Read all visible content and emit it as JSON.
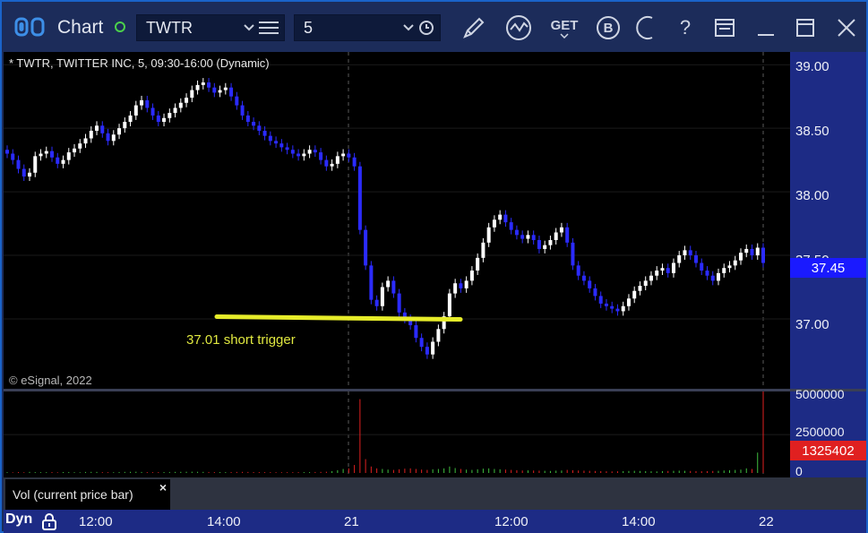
{
  "toolbar": {
    "app_title": "Chart",
    "symbol": "TWTR",
    "interval": "5",
    "get_label": "GET",
    "b_label": "B",
    "help_label": "?"
  },
  "chart": {
    "caption": "* TWTR, TWITTER INC, 5, 09:30-16:00 (Dynamic)",
    "copyright": "© eSignal, 2022",
    "annotation": "37.01 short trigger",
    "annotation_color": "#e0e840",
    "current_price": "37.45",
    "current_price_color": "#1a1aff",
    "current_volume": "1325402",
    "current_volume_color": "#e02020",
    "volume_legend": "Vol (current price bar)",
    "volume_legend_close": "×",
    "mode_label": "Dyn"
  },
  "chart_data": {
    "type": "candlestick",
    "title": "* TWTR, TWITTER INC, 5, 09:30-16:00 (Dynamic)",
    "y_axis_ticks": [
      "39.00",
      "38.50",
      "38.00",
      "37.50",
      "37.00"
    ],
    "ylim": [
      36.45,
      39.1
    ],
    "volume_axis_ticks": [
      "5000000",
      "2500000",
      "0"
    ],
    "x_axis_ticks": [
      "12:00",
      "14:00",
      "21",
      "12:00",
      "14:00",
      "22"
    ],
    "trigger_line": {
      "price": 37.01,
      "label": "37.01 short trigger"
    },
    "last_price": 37.45,
    "last_volume": 1325402,
    "closes": [
      38.3,
      38.25,
      38.18,
      38.12,
      38.15,
      38.28,
      38.3,
      38.32,
      38.27,
      38.22,
      38.25,
      38.31,
      38.34,
      38.38,
      38.42,
      38.48,
      38.52,
      38.46,
      38.4,
      38.45,
      38.5,
      38.55,
      38.6,
      38.68,
      38.72,
      38.66,
      38.6,
      38.55,
      38.58,
      38.62,
      38.66,
      38.7,
      38.74,
      38.8,
      38.84,
      38.86,
      38.82,
      38.78,
      38.8,
      38.82,
      38.75,
      38.68,
      38.6,
      38.55,
      38.52,
      38.48,
      38.44,
      38.4,
      38.38,
      38.35,
      38.33,
      38.3,
      38.28,
      38.3,
      38.33,
      38.31,
      38.25,
      38.2,
      38.22,
      38.28,
      38.3,
      38.27,
      38.2,
      37.7,
      37.42,
      37.15,
      37.1,
      37.25,
      37.3,
      37.2,
      37.05,
      37.0,
      36.95,
      36.85,
      36.78,
      36.72,
      36.82,
      36.92,
      37.02,
      37.2,
      37.28,
      37.24,
      37.3,
      37.38,
      37.48,
      37.6,
      37.72,
      37.78,
      37.82,
      37.76,
      37.7,
      37.66,
      37.63,
      37.66,
      37.62,
      37.55,
      37.58,
      37.62,
      37.68,
      37.72,
      37.6,
      37.42,
      37.34,
      37.3,
      37.24,
      37.18,
      37.12,
      37.1,
      37.08,
      37.06,
      37.1,
      37.16,
      37.22,
      37.26,
      37.3,
      37.34,
      37.38,
      37.4,
      37.36,
      37.44,
      37.5,
      37.54,
      37.5,
      37.44,
      37.38,
      37.34,
      37.3,
      37.36,
      37.4,
      37.42,
      37.46,
      37.52,
      37.55,
      37.5,
      37.56,
      37.44
    ],
    "volumes": [
      50000,
      40000,
      60000,
      45000,
      70000,
      55000,
      48000,
      52000,
      60000,
      45000,
      58000,
      62000,
      50000,
      44000,
      66000,
      72000,
      68000,
      54000,
      50000,
      48000,
      62000,
      70000,
      75000,
      80000,
      66000,
      58000,
      52000,
      56000,
      60000,
      64000,
      70000,
      74000,
      78000,
      82000,
      76000,
      70000,
      64000,
      60000,
      58000,
      56000,
      62000,
      68000,
      70000,
      66000,
      60000,
      58000,
      54000,
      52000,
      50000,
      48000,
      50000,
      52000,
      54000,
      56000,
      60000,
      64000,
      70000,
      80000,
      120000,
      180000,
      260000,
      300000,
      520000,
      4800000,
      900000,
      420000,
      300000,
      260000,
      220000,
      200000,
      240000,
      280000,
      300000,
      260000,
      220000,
      200000,
      240000,
      260000,
      300000,
      420000,
      320000,
      260000,
      220000,
      200000,
      240000,
      280000,
      300000,
      260000,
      240000,
      220000,
      200000,
      180000,
      160000,
      170000,
      160000,
      150000,
      140000,
      130000,
      150000,
      160000,
      200000,
      180000,
      160000,
      150000,
      140000,
      130000,
      120000,
      110000,
      100000,
      110000,
      120000,
      130000,
      140000,
      130000,
      120000,
      110000,
      100000,
      120000,
      130000,
      140000,
      150000,
      140000,
      130000,
      120000,
      110000,
      120000,
      130000,
      140000,
      160000,
      180000,
      200000,
      220000,
      300000,
      260000,
      1325402
    ]
  }
}
